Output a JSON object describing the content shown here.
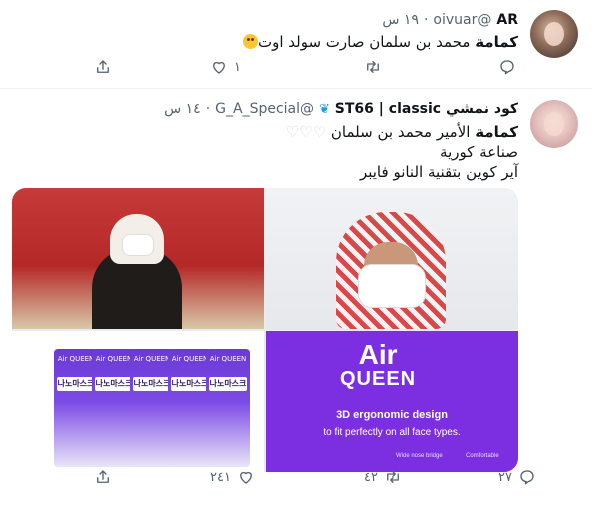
{
  "tweets": [
    {
      "display_name": "AR",
      "handle": "@oivuar",
      "time": "١٩ س",
      "text_bold": "كمامة",
      "text_normal": " محمد بن سلمان ",
      "text_tail": "صارت سولد اوت",
      "emoji": "flushed-face-icon",
      "reply_count": "",
      "retweet_count": "",
      "like_count": "١"
    },
    {
      "display_name": "كود نمشي ST66 | classic",
      "display_name_part1": "كود نمشي ST66 | ",
      "display_name_part2": "classic",
      "handle": "@G_A_Special",
      "time": "١٤ س",
      "line1_bold": "كمامة",
      "line1_normal": " الأمير محمد بن سلمان ",
      "line1_hearts": "♡♡♡",
      "line2": "صناعة كورية",
      "line3": "آير كوين بتقنية النانو فايبر",
      "reply_count": "٢٧",
      "retweet_count": "٤٢",
      "like_count": "٢٤١",
      "media": {
        "product_brand": "Air QUEEN",
        "pack_label": "나노마스크",
        "pack_brand": "Air QUEEN",
        "ad_title_1": "Air",
        "ad_title_2": "QUEEN",
        "ad_line_1": "3D ergonomic design",
        "ad_line_2": "to fit perfectly on all face types.",
        "ad_foot_1": "Wide nose bridge",
        "ad_foot_2": "Comfortable"
      }
    }
  ],
  "icons": {
    "reply": "reply-icon",
    "retweet": "retweet-icon",
    "like": "heart-icon",
    "share": "share-icon",
    "dot": "·"
  }
}
